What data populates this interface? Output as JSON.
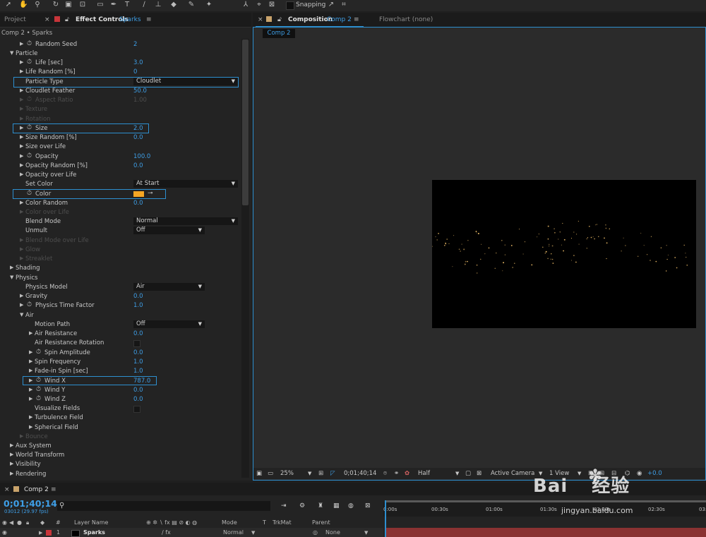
{
  "toolbar": {
    "icons": [
      "selection-tool-icon",
      "hand-tool-icon",
      "zoom-tool-icon",
      "rotate-tool-icon",
      "camera-tool-icon",
      "pan-behind-icon",
      "rectangle-tool-icon",
      "pen-tool-icon",
      "type-tool-icon",
      "brush-tool-icon",
      "clone-stamp-icon",
      "eraser-icon",
      "roto-brush-icon",
      "puppet-pin-icon"
    ],
    "snapping_label": "Snapping"
  },
  "left_tabs": {
    "project_label": "Project",
    "effect_controls_label": "Effect Controls",
    "effect_controls_target": "Sparks",
    "menu_glyph": "≡",
    "close_glyph": "×"
  },
  "breadcrumb": "Comp 2 • Sparks",
  "properties": {
    "random_seed": {
      "label": "Random Seed",
      "value": "2"
    },
    "particle": {
      "label": "Particle"
    },
    "life_sec": {
      "label": "Life [sec]",
      "value": "3.0"
    },
    "life_random": {
      "label": "Life Random [%]",
      "value": "0"
    },
    "particle_type": {
      "label": "Particle Type",
      "value": "Cloudlet"
    },
    "cloudlet_feather": {
      "label": "Cloudlet Feather",
      "value": "50.0"
    },
    "aspect_ratio": {
      "label": "Aspect Ratio",
      "value": "1.00"
    },
    "texture": {
      "label": "Texture"
    },
    "rotation": {
      "label": "Rotation"
    },
    "size": {
      "label": "Size",
      "value": "2.0"
    },
    "size_random": {
      "label": "Size Random [%]",
      "value": "0.0"
    },
    "size_over_life": {
      "label": "Size over Life"
    },
    "opacity": {
      "label": "Opacity",
      "value": "100.0"
    },
    "opacity_random": {
      "label": "Opacity Random [%]",
      "value": "0.0"
    },
    "opacity_over_life": {
      "label": "Opacity over Life"
    },
    "set_color": {
      "label": "Set Color",
      "value": "At Start"
    },
    "color": {
      "label": "Color",
      "swatch": "#f5a623"
    },
    "color_random": {
      "label": "Color Random",
      "value": "0.0"
    },
    "color_over_life": {
      "label": "Color over Life"
    },
    "blend_mode": {
      "label": "Blend Mode",
      "value": "Normal"
    },
    "unmult": {
      "label": "Unmult",
      "value": "Off"
    },
    "blend_mode_over_life": {
      "label": "Blend Mode over Life"
    },
    "glow": {
      "label": "Glow"
    },
    "streaklet": {
      "label": "Streaklet"
    },
    "shading": {
      "label": "Shading"
    },
    "physics": {
      "label": "Physics"
    },
    "physics_model": {
      "label": "Physics Model",
      "value": "Air"
    },
    "gravity": {
      "label": "Gravity",
      "value": "0.0"
    },
    "physics_time_factor": {
      "label": "Physics Time Factor",
      "value": "1.0"
    },
    "air": {
      "label": "Air"
    },
    "motion_path": {
      "label": "Motion Path",
      "value": "Off"
    },
    "air_resistance": {
      "label": "Air Resistance",
      "value": "0.0"
    },
    "air_resistance_rotation": {
      "label": "Air Resistance Rotation"
    },
    "spin_amplitude": {
      "label": "Spin Amplitude",
      "value": "0.0"
    },
    "spin_frequency": {
      "label": "Spin Frequency",
      "value": "1.0"
    },
    "fade_in_spin": {
      "label": "Fade-in Spin [sec]",
      "value": "1.0"
    },
    "wind_x": {
      "label": "Wind X",
      "value": "787.0"
    },
    "wind_y": {
      "label": "Wind Y",
      "value": "0.0"
    },
    "wind_z": {
      "label": "Wind Z",
      "value": "0.0"
    },
    "visualize_fields": {
      "label": "Visualize Fields"
    },
    "turbulence_field": {
      "label": "Turbulence Field"
    },
    "spherical_field": {
      "label": "Spherical Field"
    },
    "bounce": {
      "label": "Bounce"
    },
    "aux_system": {
      "label": "Aux System"
    },
    "world_transform": {
      "label": "World Transform"
    },
    "visibility": {
      "label": "Visibility"
    },
    "rendering": {
      "label": "Rendering"
    }
  },
  "composition": {
    "tab_prefix": "Composition",
    "tab_name": "Comp 2",
    "flowchart_label": "Flowchart (none)",
    "chip_label": "Comp 2",
    "footer": {
      "zoom": "25%",
      "timecode": "0;01;40;14",
      "resolution": "Half",
      "camera": "Active Camera",
      "views": "1 View",
      "exposure": "+0.0"
    }
  },
  "timeline": {
    "tab_label": "Comp 2",
    "timecode": "0;01;40;14",
    "fps": "03012 (29.97 fps)",
    "search_icon": "search-icon",
    "ruler_ticks": [
      "0:00s",
      "00:30s",
      "01:00s",
      "01:30s",
      "02:00s",
      "02:30s",
      "03:0"
    ],
    "headers": {
      "layer_name": "Layer Name",
      "mode": "Mode",
      "t": "T",
      "trkmat": "TrkMat",
      "parent": "Parent"
    },
    "layer": {
      "number": "1",
      "name": "Sparks",
      "mode": "Normal",
      "parent": "None",
      "label_color": "#c8353a",
      "bar_color": "#8a3232"
    }
  },
  "watermark": {
    "brand": "Bai",
    "brand_cn": "经验",
    "url": "jingyan.baidu.com"
  }
}
